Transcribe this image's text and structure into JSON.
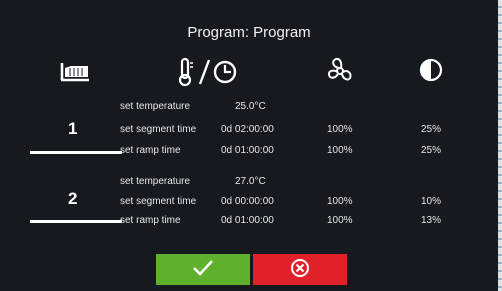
{
  "title": "Program: Program",
  "header_icons": [
    "ramp-icon",
    "temperature-time-icon",
    "fan-icon",
    "contrast-icon"
  ],
  "segments": [
    {
      "number": "1",
      "rows": [
        {
          "label": "set temperature",
          "value": "25.0°C",
          "fan": "",
          "pct": ""
        },
        {
          "label": "set segment time",
          "value": "0d 02:00:00",
          "fan": "100%",
          "pct": "25%"
        },
        {
          "label": "set ramp time",
          "value": "0d 01:00:00",
          "fan": "100%",
          "pct": "25%"
        }
      ]
    },
    {
      "number": "2",
      "rows": [
        {
          "label": "set temperature",
          "value": "27.0°C",
          "fan": "",
          "pct": ""
        },
        {
          "label": "set segment time",
          "value": "0d 00:00:00",
          "fan": "100%",
          "pct": "10%"
        },
        {
          "label": "set ramp time",
          "value": "0d 01:00:00",
          "fan": "100%",
          "pct": "13%"
        }
      ]
    }
  ],
  "buttons": {
    "confirm": "check-icon",
    "cancel": "cancel-x-icon"
  },
  "colors": {
    "background": "#16191d",
    "confirm": "#5fb12d",
    "cancel": "#e0212a",
    "text": "#ffffff"
  }
}
